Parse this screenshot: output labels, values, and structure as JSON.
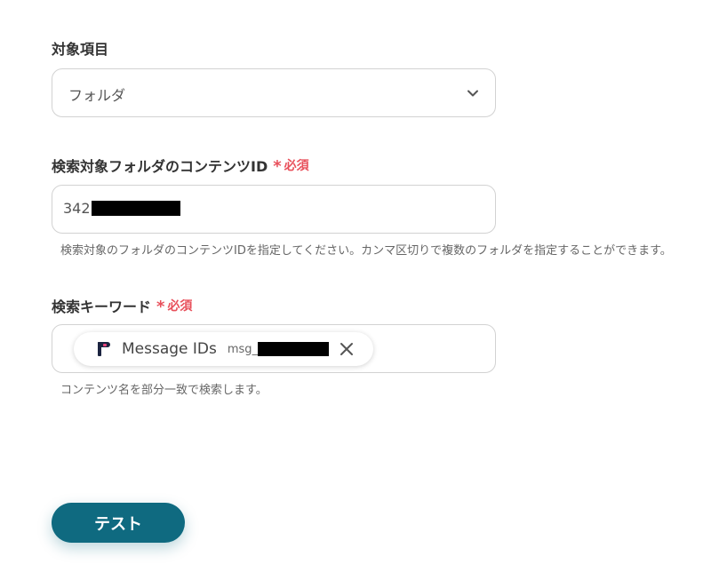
{
  "target_item": {
    "label": "対象項目",
    "selected": "フォルダ",
    "icon": "chevron-down-icon"
  },
  "folder_id": {
    "label": "検索対象フォルダのコンテンツID",
    "required_mark": "*",
    "required_label": "必須",
    "value_prefix": "342",
    "hint": "検索対象のフォルダのコンテンツIDを指定してください。カンマ区切りで複数のフォルダを指定することができます。"
  },
  "keyword": {
    "label": "検索キーワード",
    "required_mark": "*",
    "required_label": "必須",
    "chip": {
      "icon": "app-logo-icon",
      "label": "Message IDs",
      "sub_prefix": "msg_",
      "close_icon": "close-icon"
    },
    "hint": "コンテンツ名を部分一致で検索します。"
  },
  "actions": {
    "test_label": "テスト"
  },
  "colors": {
    "required": "#e8505b",
    "button": "#0f6a80",
    "border": "#d2d2d2"
  }
}
